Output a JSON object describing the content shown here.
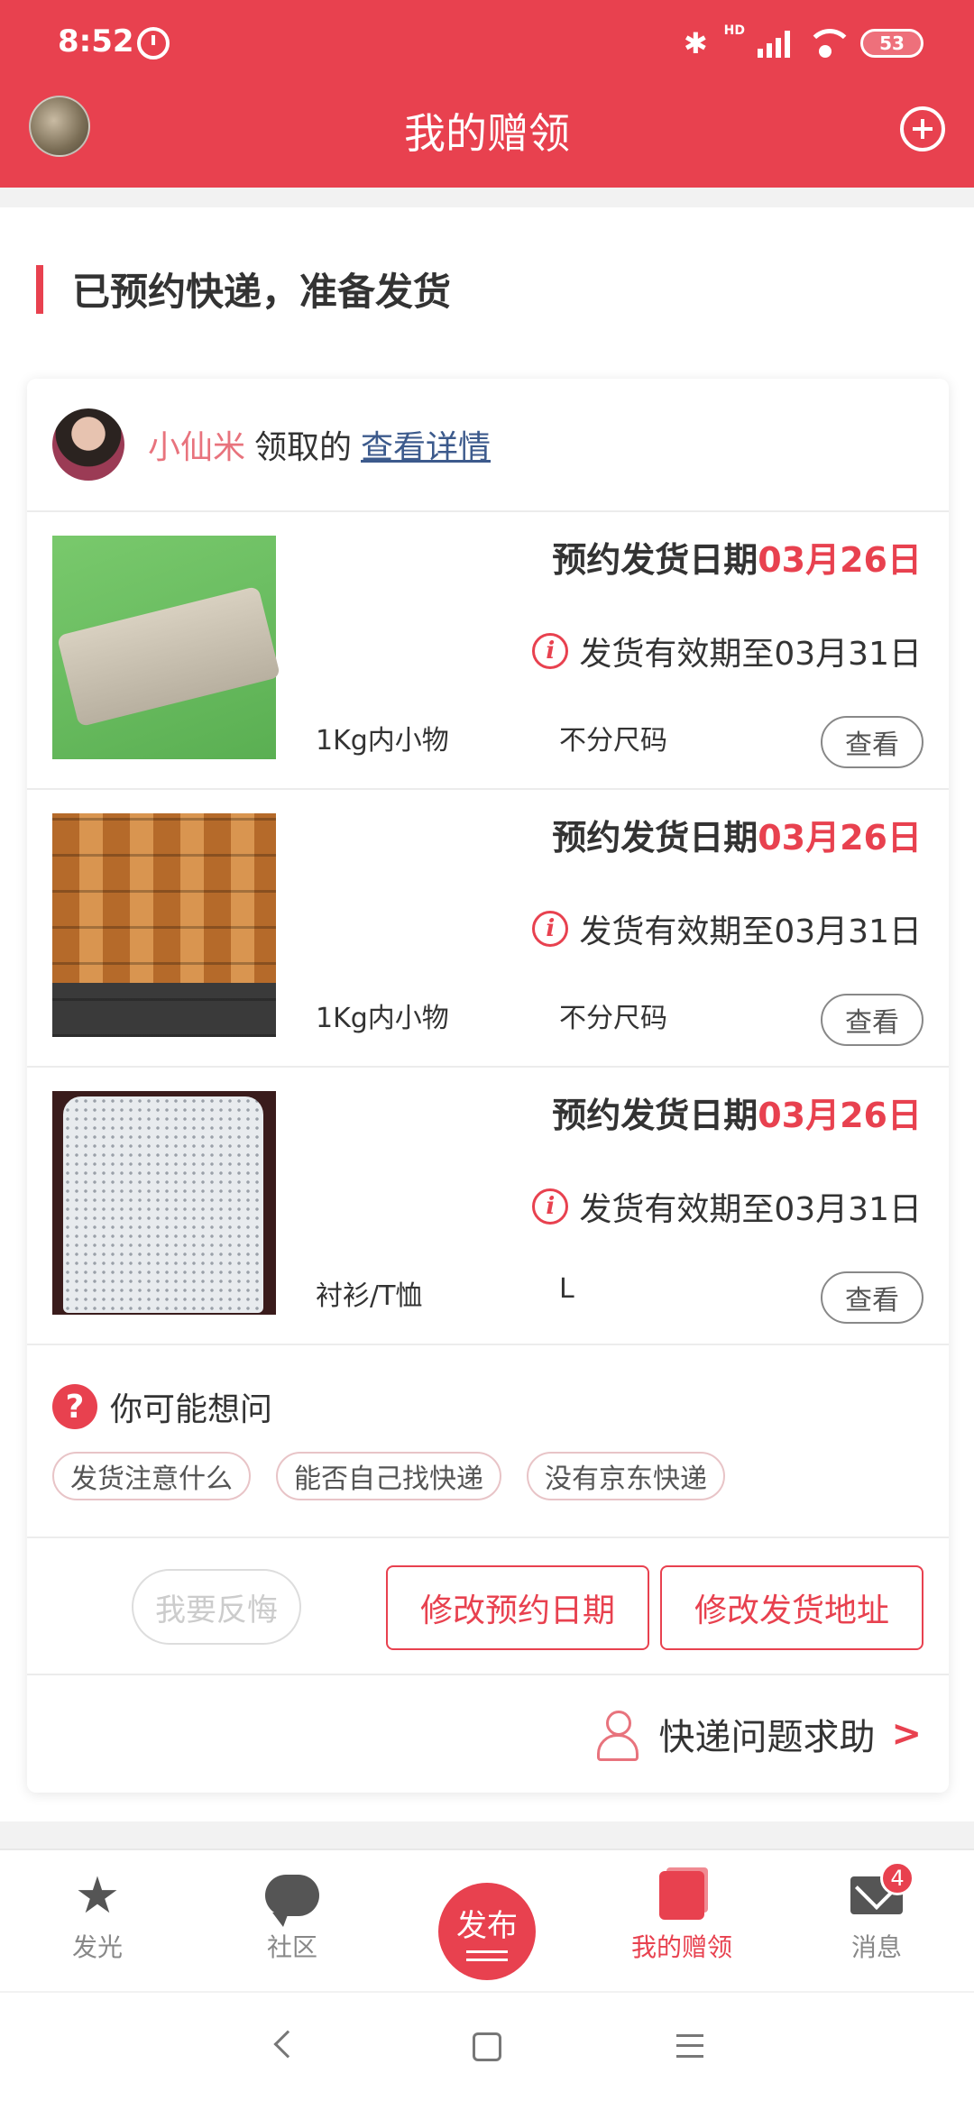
{
  "status_bar": {
    "time": "8:52",
    "battery": "53",
    "network_label": "HD"
  },
  "header": {
    "title": "我的赠领"
  },
  "section": {
    "title": "已预约快递，准备发货"
  },
  "receiver": {
    "name": "小仙米",
    "action": "领取的",
    "detail_link": "查看详情"
  },
  "items": [
    {
      "date_label": "预约发货日期",
      "date_value": "03月26日",
      "expire_text": "发货有效期至03月31日",
      "category": "1Kg内小物",
      "size": "不分尺码",
      "view_label": "查看"
    },
    {
      "date_label": "预约发货日期",
      "date_value": "03月26日",
      "expire_text": "发货有效期至03月31日",
      "category": "1Kg内小物",
      "size": "不分尺码",
      "view_label": "查看"
    },
    {
      "date_label": "预约发货日期",
      "date_value": "03月26日",
      "expire_text": "发货有效期至03月31日",
      "category": "衬衫/T恤",
      "size": "L",
      "view_label": "查看"
    }
  ],
  "faq": {
    "title": "你可能想问",
    "tags": [
      "发货注意什么",
      "能否自己找快递",
      "没有京东快递"
    ]
  },
  "actions": {
    "regret": "我要反悔",
    "change_date": "修改预约日期",
    "change_address": "修改发货地址"
  },
  "help": {
    "label": "快递问题求助"
  },
  "bottom_nav": {
    "items": [
      {
        "label": "发光",
        "icon": "star-icon"
      },
      {
        "label": "社区",
        "icon": "chat-icon"
      },
      {
        "label": "发布",
        "icon": "publish-icon"
      },
      {
        "label": "我的赠领",
        "icon": "gift-icon",
        "active": true
      },
      {
        "label": "消息",
        "icon": "mail-icon",
        "badge": "4"
      }
    ]
  },
  "colors": {
    "brand": "#e8414f",
    "link": "#3c5a8c",
    "receiver_name": "#e8737d"
  }
}
